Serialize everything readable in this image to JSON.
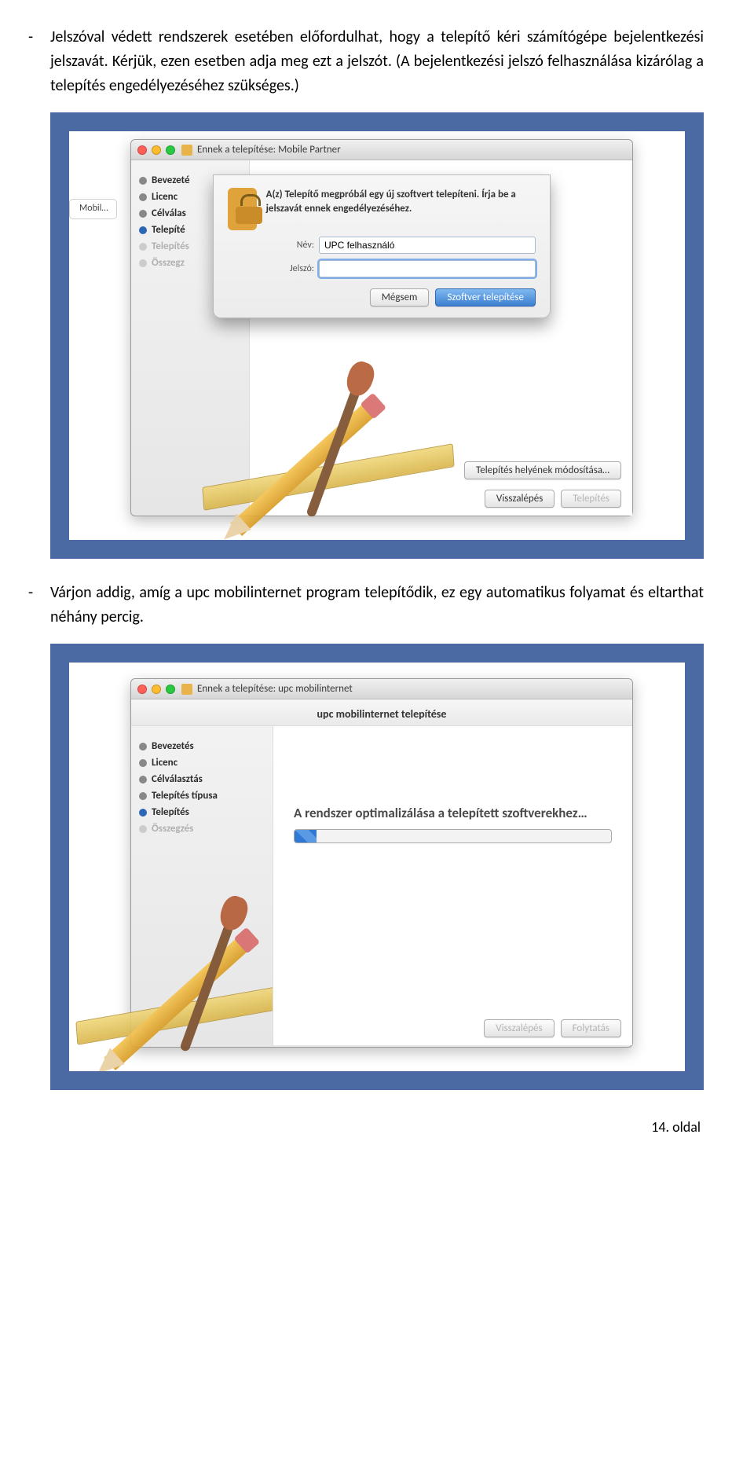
{
  "intro1": "Jelszóval védett rendszerek esetében előfordulhat, hogy a telepítő kéri számítógépe bejelentkezési jelszavát. Kérjük, ezen esetben adja meg ezt a jelszót. (A bejelentkezési jelszó felhasználása kizárólag a telepítés engedélyezéséhez szükséges.)",
  "intro2": "Várjon addig, amíg a upc mobilinternet program telepítődik, ez egy automatikus folyamat és eltarthat néhány percig.",
  "dash": "-",
  "under_tab": "Mobil…",
  "win1": {
    "title": "Ennek a telepítése: Mobile Partner",
    "steps": [
      "Bevezeté",
      "Licenc",
      "Célválas",
      "Telepíté",
      "Telepítés",
      "Összegz"
    ],
    "change_loc": "Telepítés helyének módosítása…",
    "back": "Visszalépés",
    "install": "Telepítés",
    "sheet": {
      "msg": "A(z) Telepítő megpróbál egy új szoftvert telepíteni. Írja be a jelszavát ennek engedélyezéséhez.",
      "name_label": "Név:",
      "name_value": "UPC felhasználó",
      "pass_label": "Jelszó:",
      "pass_value": "",
      "cancel": "Mégsem",
      "ok": "Szoftver telepítése"
    }
  },
  "win2": {
    "title": "Ennek a telepítése: upc mobilinternet",
    "header": "upc mobilinternet telepítése",
    "steps": [
      "Bevezetés",
      "Licenc",
      "Célválasztás",
      "Telepítés típusa",
      "Telepítés",
      "Összegzés"
    ],
    "status": "A rendszer optimalizálása a telepített szoftverekhez…",
    "back": "Visszalépés",
    "cont": "Folytatás"
  },
  "page_num": "14. oldal"
}
